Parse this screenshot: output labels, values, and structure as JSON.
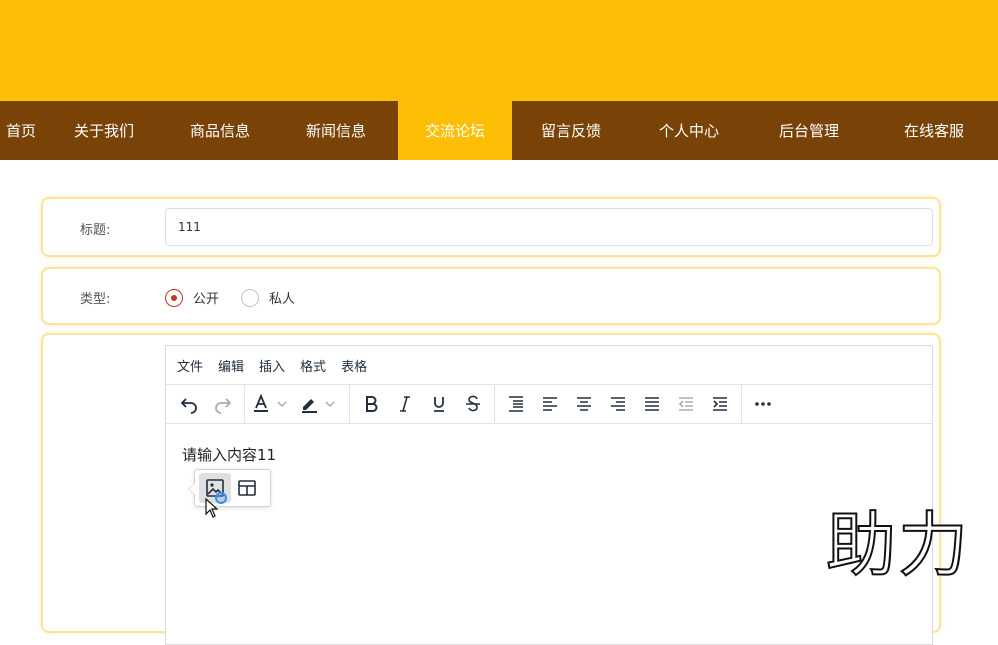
{
  "nav": {
    "items": [
      {
        "label": "首页"
      },
      {
        "label": "关于我们"
      },
      {
        "label": "商品信息"
      },
      {
        "label": "新闻信息"
      },
      {
        "label": "交流论坛"
      },
      {
        "label": "留言反馈"
      },
      {
        "label": "个人中心"
      },
      {
        "label": "后台管理"
      },
      {
        "label": "在线客服"
      }
    ],
    "active_label": "交流论坛"
  },
  "form": {
    "title_label": "标题:",
    "title_value": "111",
    "type_label": "类型:",
    "type_options": [
      {
        "label": "公开",
        "checked": true
      },
      {
        "label": "私人",
        "checked": false
      }
    ]
  },
  "editor": {
    "menu": [
      "文件",
      "编辑",
      "插入",
      "格式",
      "表格"
    ],
    "content_text": "请输入内容11",
    "quick_toolbar": [
      "image-icon",
      "table-icon"
    ]
  },
  "watermark": "助力"
}
